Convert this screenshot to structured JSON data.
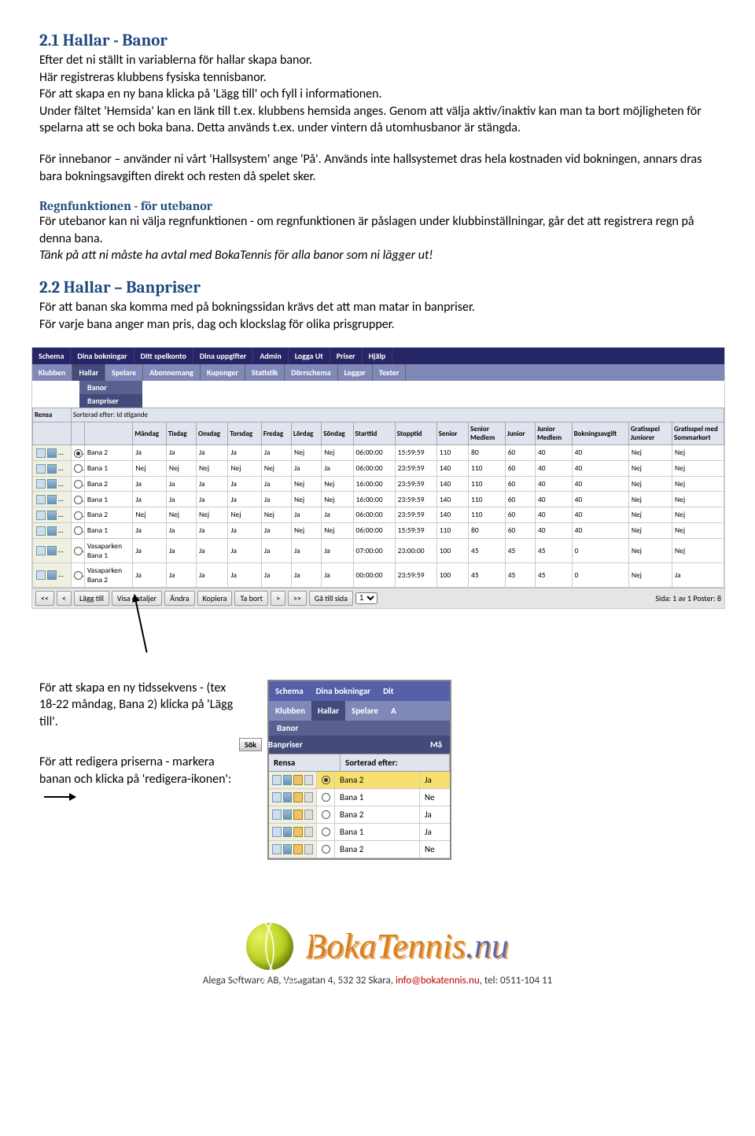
{
  "s21": {
    "title": "2.1  Hallar - Banor",
    "p1": "Efter det ni ställt in variablerna för hallar skapa banor.",
    "p2": "Här registreras klubbens fysiska tennisbanor.",
    "p3": "För att skapa en ny bana klicka på 'Lägg till' och fyll i informationen.",
    "p4": "Under fältet 'Hemsida' kan en länk till t.ex. klubbens hemsida anges. Genom att välja aktiv/inaktiv kan man ta bort möjligheten för spelarna att se och boka bana. Detta används t.ex. under vintern då utomhusbanor är stängda.",
    "p5": "För innebanor – använder ni vårt 'Hallsystem' ange 'På'. Används inte hallsystemet dras hela kostnaden vid bokningen, annars dras bara bokningsavgiften direkt och resten då spelet sker.",
    "sub": "Regnfunktionen - för utebanor",
    "p6": "För utebanor kan ni välja regnfunktionen - om regnfunktionen är påslagen under klubbinställningar, går det att registrera regn på denna bana.",
    "p7": "Tänk på att ni måste ha avtal med BokaTennis för alla banor som ni lägger ut!"
  },
  "s22": {
    "title": "2.2  Hallar – Banpriser",
    "p1": "För att banan ska komma med på bokningssidan krävs det att man matar in banpriser.",
    "p2": "För varje bana anger man pris, dag och klockslag för olika prisgrupper."
  },
  "nav1": [
    "Schema",
    "Dina bokningar",
    "Ditt spelkonto",
    "Dina uppgifter",
    "Admin",
    "Logga Ut",
    "Priser",
    "Hjälp"
  ],
  "nav2": [
    "Klubben",
    "Hallar",
    "Spelare",
    "Abonnemang",
    "Kuponger",
    "Statistik",
    "Dörrschema",
    "Loggar",
    "Texter"
  ],
  "sub_banor": "Banor",
  "sub_banpriser": "Banpriser",
  "th": {
    "rensa": "Rensa",
    "sort": "Sorterad efter: Id stigande",
    "c": [
      "",
      "",
      "",
      "Måndag",
      "Tisdag",
      "Onsdag",
      "Torsdag",
      "Fredag",
      "Lördag",
      "Söndag",
      "Starttid",
      "Stopptid",
      "Senior",
      "Senior Medlem",
      "Junior",
      "Junior Medlem",
      "Bokningsavgift",
      "Gratisspel Juniorer",
      "Gratisspel med Sommarkort"
    ]
  },
  "rows": [
    {
      "n": "Bana 2",
      "d": [
        "Ja",
        "Ja",
        "Ja",
        "Ja",
        "Ja",
        "Nej",
        "Nej"
      ],
      "st": "06:00:00",
      "sp": "15:59:59",
      "p": [
        "110",
        "80",
        "60",
        "40",
        "40"
      ],
      "g": [
        "Nej",
        "Nej"
      ],
      "sel": true
    },
    {
      "n": "Bana 1",
      "d": [
        "Nej",
        "Nej",
        "Nej",
        "Nej",
        "Nej",
        "Ja",
        "Ja"
      ],
      "st": "06:00:00",
      "sp": "23:59:59",
      "p": [
        "140",
        "110",
        "60",
        "40",
        "40"
      ],
      "g": [
        "Nej",
        "Nej"
      ]
    },
    {
      "n": "Bana 2",
      "d": [
        "Ja",
        "Ja",
        "Ja",
        "Ja",
        "Ja",
        "Nej",
        "Nej"
      ],
      "st": "16:00:00",
      "sp": "23:59:59",
      "p": [
        "140",
        "110",
        "60",
        "40",
        "40"
      ],
      "g": [
        "Nej",
        "Nej"
      ]
    },
    {
      "n": "Bana 1",
      "d": [
        "Ja",
        "Ja",
        "Ja",
        "Ja",
        "Ja",
        "Nej",
        "Nej"
      ],
      "st": "16:00:00",
      "sp": "23:59:59",
      "p": [
        "140",
        "110",
        "60",
        "40",
        "40"
      ],
      "g": [
        "Nej",
        "Nej"
      ]
    },
    {
      "n": "Bana 2",
      "d": [
        "Nej",
        "Nej",
        "Nej",
        "Nej",
        "Nej",
        "Ja",
        "Ja"
      ],
      "st": "06:00:00",
      "sp": "23:59:59",
      "p": [
        "140",
        "110",
        "60",
        "40",
        "40"
      ],
      "g": [
        "Nej",
        "Nej"
      ]
    },
    {
      "n": "Bana 1",
      "d": [
        "Ja",
        "Ja",
        "Ja",
        "Ja",
        "Ja",
        "Nej",
        "Nej"
      ],
      "st": "06:00:00",
      "sp": "15:59:59",
      "p": [
        "110",
        "80",
        "60",
        "40",
        "40"
      ],
      "g": [
        "Nej",
        "Nej"
      ]
    },
    {
      "n": "Vasaparken Bana 1",
      "d": [
        "Ja",
        "Ja",
        "Ja",
        "Ja",
        "Ja",
        "Ja",
        "Ja"
      ],
      "st": "07:00:00",
      "sp": "23:00:00",
      "p": [
        "100",
        "45",
        "45",
        "45",
        "0"
      ],
      "g": [
        "Nej",
        "Nej"
      ]
    },
    {
      "n": "Vasaparken Bana 2",
      "d": [
        "Ja",
        "Ja",
        "Ja",
        "Ja",
        "Ja",
        "Ja",
        "Ja"
      ],
      "st": "00:00:00",
      "sp": "23:59:59",
      "p": [
        "100",
        "45",
        "45",
        "45",
        "0"
      ],
      "g": [
        "Nej",
        "Ja"
      ]
    }
  ],
  "btns": {
    "first": "<<",
    "prev": "<",
    "add": "Lägg till",
    "det": "Visa detaljer",
    "edit": "Ändra",
    "copy": "Kopiera",
    "del": "Ta bort",
    "next": ">",
    "last": ">>",
    "page": "Gå till sida",
    "pageVal": "1",
    "right": "Sida: 1 av 1  Poster: 8"
  },
  "foot": {
    "t1": "För att skapa en ny tidssekvens - (tex 18-22 måndag, Bana 2) klicka på 'Lägg till'.",
    "t2": "För att redigera priserna - markera banan och klicka på 'redigera-ikonen':"
  },
  "mini": {
    "top": [
      "Schema",
      "Dina bokningar",
      "Dit"
    ],
    "mid": [
      "Klubben",
      "Hallar",
      "Spelare",
      "A"
    ],
    "s1": "Banor",
    "s2": "Banpriser",
    "sok": "Sök",
    "hdr": [
      "Rensa",
      "Sorterad efter:"
    ],
    "rows": [
      {
        "n": "Bana 2",
        "v": "Ja",
        "sel": true
      },
      {
        "n": "Bana 1",
        "v": "Ne"
      },
      {
        "n": "Bana 2",
        "v": "Ja"
      },
      {
        "n": "Bana 1",
        "v": "Ja"
      },
      {
        "n": "Bana 2",
        "v": "Ne"
      }
    ],
    "ma": "Må"
  },
  "footer": {
    "logo": "BokaTennis",
    "nu": ".nu",
    "line_pre": "Alega Software AB, Vasagatan 4, 532 32 Skara, ",
    "mail": "info@bokatennis.nu",
    "line_post": ", tel: 0511-104 11"
  }
}
